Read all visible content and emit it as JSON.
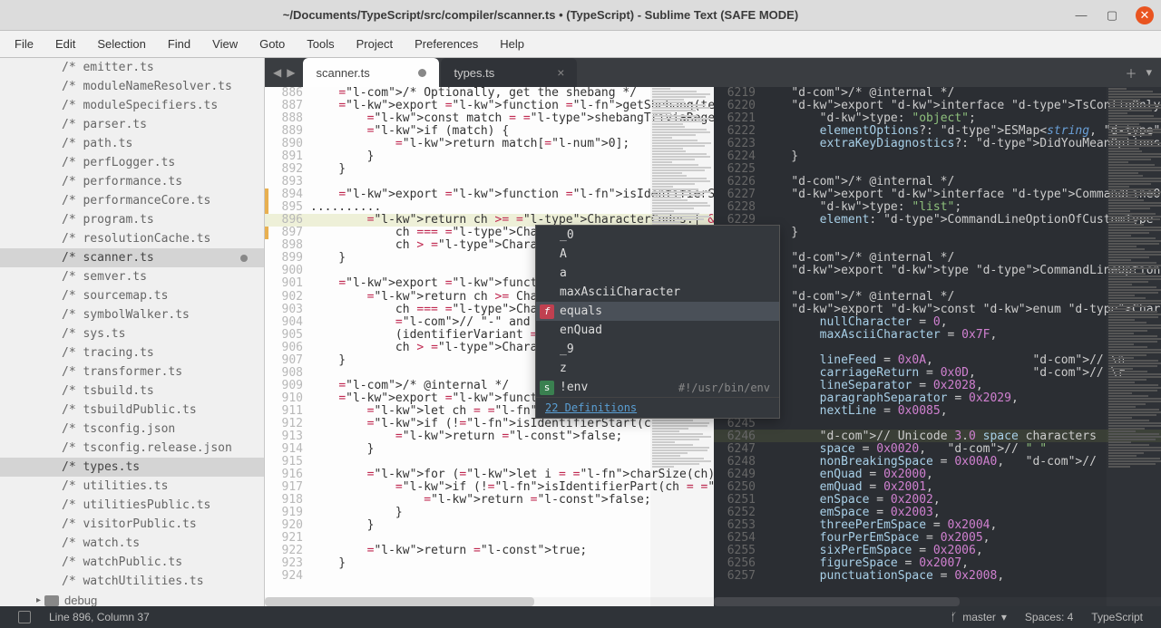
{
  "title": "~/Documents/TypeScript/src/compiler/scanner.ts • (TypeScript) - Sublime Text (SAFE MODE)",
  "menu": [
    "File",
    "Edit",
    "Selection",
    "Find",
    "View",
    "Goto",
    "Tools",
    "Project",
    "Preferences",
    "Help"
  ],
  "sidebar": {
    "items": [
      "/* emitter.ts",
      "/* moduleNameResolver.ts",
      "/* moduleSpecifiers.ts",
      "/* parser.ts",
      "/* path.ts",
      "/* perfLogger.ts",
      "/* performance.ts",
      "/* performanceCore.ts",
      "/* program.ts",
      "/* resolutionCache.ts",
      "/* scanner.ts",
      "/* semver.ts",
      "/* sourcemap.ts",
      "/* symbolWalker.ts",
      "/* sys.ts",
      "/* tracing.ts",
      "/* transformer.ts",
      "/* tsbuild.ts",
      "/* tsbuildPublic.ts",
      "/* tsconfig.json",
      "/* tsconfig.release.json",
      "/* types.ts",
      "/* utilities.ts",
      "/* utilitiesPublic.ts",
      "/* visitorPublic.ts",
      "/* watch.ts",
      "/* watchPublic.ts",
      "/* watchUtilities.ts"
    ],
    "active_index": 10,
    "secondary_active_index": 21,
    "folder": "debug"
  },
  "tabs": [
    {
      "label": "scanner.ts",
      "dirty": true,
      "theme": "light"
    },
    {
      "label": "types.ts",
      "dirty": false,
      "theme": "dark"
    }
  ],
  "left_editor": {
    "first_line": 886,
    "lines": [
      "    /* Optionally, get the shebang */",
      "    export function getShebang(text: string): strin",
      "        const match = shebangTriviaRegex.exec(text)",
      "        if (match) {",
      "            return match[0];",
      "        }",
      "    }",
      "",
      "    export function isIdentifierStart(ch: number, l",
      "..........",
      "        return ch >= CharacterCodes.| && ch <= Chara",
      "            ch === CharacterCode",
      "            ch > CharacterCodes.",
      "    }",
      "",
      "    export function isIdentifier",
      "        return ch >= CharacterCo",
      "            ch === CharacterCodes",
      "            // \"-\" and \":\" are v",
      "            (identifierVariant =",
      "            ch > CharacterCodes.",
      "    }",
      "",
      "    /* @internal */",
      "    export function isIdentifier",
      "        let ch = codePointAt(nam",
      "        if (!isIdentifierStart(c",
      "            return false;",
      "        }",
      "",
      "        for (let i = charSize(ch); i < name.length;",
      "            if (!isIdentifierPart(ch = codePointAt(",
      "                return false;",
      "            }",
      "        }",
      "",
      "        return true;",
      "    }",
      ""
    ],
    "cursor": {
      "line": 896,
      "col": 37
    }
  },
  "right_editor": {
    "first_line": 6219,
    "lines": [
      "    /* @internal */",
      "    export interface TsConfigOnlyOption extends Com",
      "        type: \"object\";",
      "        elementOptions?: ESMap<string, CommandLineO",
      "        extraKeyDiagnostics?: DidYouMeanOptionsDiag",
      "    }",
      "",
      "    /* @internal */",
      "    export interface CommandLineOptionOfListType ex",
      "        type: \"list\";",
      "        element: CommandLineOptionOfCustomType | Co",
      "    }",
      "",
      "    /* @internal */",
      "    export type CommandLineOption = CommandLineOpti",
      "",
      "    /* @internal */",
      "    export const enum CharacterCodes {",
      "        nullCharacter = 0,",
      "        maxAsciiCharacter = 0x7F,",
      "",
      "        lineFeed = 0x0A,              // \\n",
      "        carriageReturn = 0x0D,        // \\r",
      "        lineSeparator = 0x2028,",
      "        paragraphSeparator = 0x2029,",
      "        nextLine = 0x0085,",
      "",
      "        // Unicode 3.0 space characters",
      "        space = 0x0020,   // \" \"",
      "        nonBreakingSpace = 0x00A0,   //",
      "        enQuad = 0x2000,",
      "        emQuad = 0x2001,",
      "        enSpace = 0x2002,",
      "        emSpace = 0x2003,",
      "        threePerEmSpace = 0x2004,",
      "        fourPerEmSpace = 0x2005,",
      "        sixPerEmSpace = 0x2006,",
      "        figureSpace = 0x2007,",
      "        punctuationSpace = 0x2008,"
    ],
    "highlight_line": 6246
  },
  "autocomplete": {
    "items": [
      {
        "label": "_0",
        "icon": ""
      },
      {
        "label": "A",
        "icon": ""
      },
      {
        "label": "a",
        "icon": ""
      },
      {
        "label": "maxAsciiCharacter",
        "icon": ""
      },
      {
        "label": "equals",
        "icon": "f"
      },
      {
        "label": "enQuad",
        "icon": ""
      },
      {
        "label": "_9",
        "icon": ""
      },
      {
        "label": "z",
        "icon": ""
      },
      {
        "label": "!env",
        "icon": "s",
        "hint": "#!/usr/bin/env"
      }
    ],
    "selected": 4,
    "footer": "22 Definitions"
  },
  "statusbar": {
    "position": "Line 896, Column 37",
    "branch": "master",
    "spaces": "Spaces: 4",
    "lang": "TypeScript"
  }
}
